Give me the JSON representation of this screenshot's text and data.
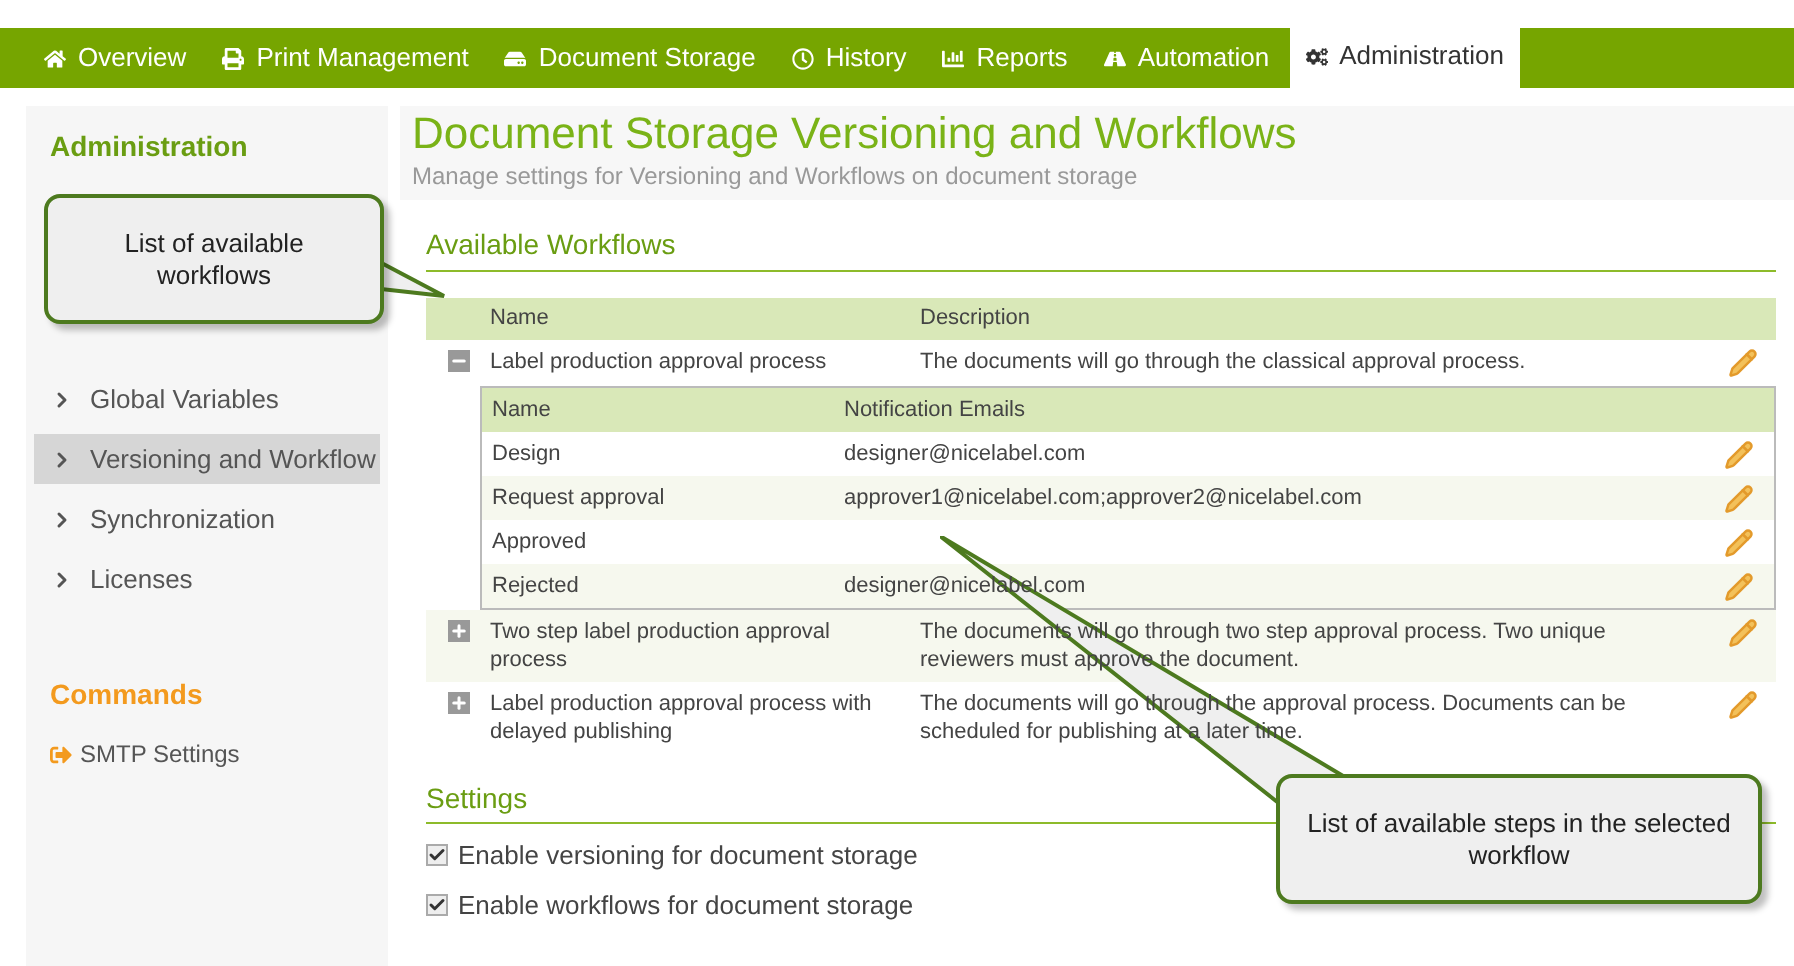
{
  "nav_tabs": [
    {
      "label": "Overview",
      "selected": false
    },
    {
      "label": "Print Management",
      "selected": false
    },
    {
      "label": "Document Storage",
      "selected": false
    },
    {
      "label": "History",
      "selected": false
    },
    {
      "label": "Reports",
      "selected": false
    },
    {
      "label": "Automation",
      "selected": false
    },
    {
      "label": "Administration",
      "selected": true
    }
  ],
  "sidebar": {
    "title": "Administration",
    "items": [
      {
        "label": "Global Variables",
        "selected": false
      },
      {
        "label": "Versioning and Workflow",
        "selected": true
      },
      {
        "label": "Synchronization",
        "selected": false
      },
      {
        "label": "Licenses",
        "selected": false
      }
    ],
    "commands_title": "Commands",
    "commands": [
      {
        "label": "SMTP Settings"
      }
    ]
  },
  "page": {
    "title": "Document Storage Versioning and Workflows",
    "subtitle": "Manage settings for Versioning and Workflows on document storage"
  },
  "workflows": {
    "heading": "Available Workflows",
    "columns": [
      "Name",
      "Description"
    ],
    "step_columns": [
      "Name",
      "Notification Emails"
    ],
    "rows": [
      {
        "name": "Label production approval process",
        "description": "The documents will go through the classical approval process.",
        "expanded": true,
        "steps": [
          {
            "name": "Design",
            "emails": "designer@nicelabel.com"
          },
          {
            "name": "Request approval",
            "emails": "approver1@nicelabel.com;approver2@nicelabel.com"
          },
          {
            "name": "Approved"
          },
          {
            "name": "Rejected",
            "emails": "designer@nicelabel.com"
          }
        ]
      },
      {
        "name": "Two step label production approval process",
        "description": "The documents will go through two step approval process. Two unique reviewers must approve the document.",
        "expanded": false
      },
      {
        "name": "Label production approval process with delayed publishing",
        "description": "The documents will go through the approval process. Documents can be scheduled for publishing at a later time.",
        "expanded": false
      }
    ]
  },
  "settings": {
    "heading": "Settings",
    "options": [
      {
        "label": "Enable versioning for document storage",
        "checked": true
      },
      {
        "label": "Enable workflows for document storage",
        "checked": true
      }
    ]
  },
  "callouts": [
    {
      "text": "List of available workflows"
    },
    {
      "text": "List of available steps in the selected workflow"
    }
  ]
}
